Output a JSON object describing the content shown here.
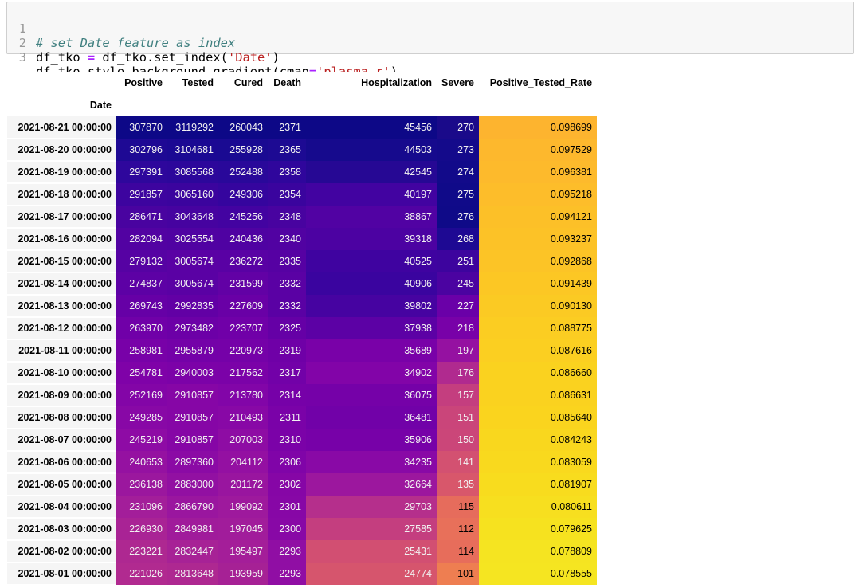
{
  "code_cell": {
    "line_numbers": [
      "1",
      "2",
      "3"
    ],
    "line1": {
      "comment": "# set Date feature as index"
    },
    "line2": {
      "lhs": "df_tko ",
      "op": "=",
      "call": " df_tko.set_index(",
      "arg": "'Date'",
      "close": ")"
    },
    "line3": {
      "call": "df_tko.style.background_gradient(cmap",
      "op": "=",
      "arg": "'plasma_r'",
      "close": ")"
    }
  },
  "table": {
    "index_name": "Date",
    "columns": [
      "Positive",
      "Tested",
      "Cured",
      "Death",
      "Hospitalization",
      "Severe",
      "Positive_Tested_Rate"
    ],
    "rows": [
      {
        "date": "2021-08-21 00:00:00",
        "cells": [
          "307870",
          "3119292",
          "260043",
          "2371",
          "45456",
          "270",
          "0.098699"
        ],
        "bg": [
          "#0d0887",
          "#0d0887",
          "#0d0887",
          "#0d0887",
          "#0d0887",
          "#1a0a8a",
          "#fdb42f"
        ]
      },
      {
        "date": "2021-08-20 00:00:00",
        "cells": [
          "302796",
          "3104681",
          "255928",
          "2365",
          "44503",
          "273",
          "0.097529"
        ],
        "bg": [
          "#1e0994",
          "#1b0993",
          "#1a0a92",
          "#1d0a93",
          "#160a8d",
          "#140a8b",
          "#fdb82d"
        ]
      },
      {
        "date": "2021-08-19 00:00:00",
        "cells": [
          "297391",
          "3085568",
          "252488",
          "2358",
          "42545",
          "274",
          "0.096381"
        ],
        "bg": [
          "#2e079c",
          "#2c079b",
          "#29089a",
          "#2f069c",
          "#260894",
          "#120a8a",
          "#fdba2c"
        ]
      },
      {
        "date": "2021-08-18 00:00:00",
        "cells": [
          "291857",
          "3065160",
          "249306",
          "2354",
          "40197",
          "275",
          "0.095218"
        ],
        "bg": [
          "#3d049f",
          "#3b049e",
          "#35059e",
          "#3a049e",
          "#4203a1",
          "#100a89",
          "#fdbd2a"
        ]
      },
      {
        "date": "2021-08-17 00:00:00",
        "cells": [
          "286471",
          "3043648",
          "245256",
          "2348",
          "38867",
          "276",
          "0.094121"
        ],
        "bg": [
          "#4903a0",
          "#4603a0",
          "#4303a1",
          "#4803a0",
          "#5102a3",
          "#0f0a88",
          "#fcc028"
        ]
      },
      {
        "date": "2021-08-16 00:00:00",
        "cells": [
          "282094",
          "3025554",
          "240436",
          "2340",
          "39318",
          "268",
          "0.093237"
        ],
        "bg": [
          "#5202a2",
          "#5002a2",
          "#4f02a2",
          "#5102a2",
          "#4c02a2",
          "#1e0993",
          "#fcc227"
        ]
      },
      {
        "date": "2021-08-15 00:00:00",
        "cells": [
          "279132",
          "3005674",
          "236272",
          "2335",
          "40525",
          "251",
          "0.092868"
        ],
        "bg": [
          "#5602a3",
          "#5a01a4",
          "#5901a4",
          "#5601a3",
          "#3f03a0",
          "#3d049e",
          "#fcc426"
        ]
      },
      {
        "date": "2021-08-14 00:00:00",
        "cells": [
          "274837",
          "3005674",
          "231599",
          "2332",
          "40906",
          "245",
          "0.091439"
        ],
        "bg": [
          "#5d01a5",
          "#5a01a4",
          "#6201a5",
          "#5a01a4",
          "#3a049f",
          "#4b03a1",
          "#fcc724"
        ]
      },
      {
        "date": "2021-08-13 00:00:00",
        "cells": [
          "269743",
          "2992835",
          "227609",
          "2332",
          "39802",
          "227",
          "0.090130"
        ],
        "bg": [
          "#6600a6",
          "#6200a5",
          "#6900a6",
          "#5a01a4",
          "#4603a1",
          "#6a00a8",
          "#fbca23"
        ]
      },
      {
        "date": "2021-08-12 00:00:00",
        "cells": [
          "263970",
          "2973482",
          "223707",
          "2325",
          "37938",
          "218",
          "0.088775"
        ],
        "bg": [
          "#7000a8",
          "#6c00a7",
          "#7000a8",
          "#6500a6",
          "#5c01a5",
          "#7801a8",
          "#fbcd22"
        ]
      },
      {
        "date": "2021-08-11 00:00:00",
        "cells": [
          "258981",
          "2955879",
          "220973",
          "2319",
          "35689",
          "197",
          "0.087616"
        ],
        "bg": [
          "#7801a8",
          "#7401a8",
          "#7501a8",
          "#6f00a7",
          "#7901a8",
          "#9511a1",
          "#fbcf21"
        ]
      },
      {
        "date": "2021-08-10 00:00:00",
        "cells": [
          "254781",
          "2940003",
          "217562",
          "2317",
          "34902",
          "176",
          "0.086660"
        ],
        "bg": [
          "#7f02a8",
          "#7c02a8",
          "#7b02a8",
          "#7201a8",
          "#8204a8",
          "#b02a8f",
          "#fad21f"
        ]
      },
      {
        "date": "2021-08-09 00:00:00",
        "cells": [
          "252169",
          "2910857",
          "213780",
          "2314",
          "36075",
          "157",
          "0.086631"
        ],
        "bg": [
          "#8305a7",
          "#8606a6",
          "#8205a8",
          "#7601a8",
          "#7501a8",
          "#c43e7f",
          "#fad21f"
        ]
      },
      {
        "date": "2021-08-08 00:00:00",
        "cells": [
          "249285",
          "2910857",
          "210493",
          "2311",
          "36481",
          "151",
          "0.085640"
        ],
        "bg": [
          "#8808a6",
          "#8606a6",
          "#8808a6",
          "#7a02a8",
          "#7101a8",
          "#ca457a",
          "#fad41e"
        ]
      },
      {
        "date": "2021-08-07 00:00:00",
        "cells": [
          "245219",
          "2910857",
          "207003",
          "2310",
          "35906",
          "150",
          "0.084243"
        ],
        "bg": [
          "#8e0ba5",
          "#8606a6",
          "#8e0ca4",
          "#7b02a8",
          "#7701a8",
          "#cb4679",
          "#f9d71e"
        ]
      },
      {
        "date": "2021-08-06 00:00:00",
        "cells": [
          "240653",
          "2897360",
          "204112",
          "2306",
          "34235",
          "141",
          "0.083059"
        ],
        "bg": [
          "#9511a1",
          "#8b0aa5",
          "#9410a2",
          "#8004a8",
          "#8909a6",
          "#d35171",
          "#f9d91e"
        ]
      },
      {
        "date": "2021-08-05 00:00:00",
        "cells": [
          "236138",
          "2883000",
          "201172",
          "2302",
          "32664",
          "135",
          "0.081907"
        ],
        "bg": [
          "#9b179e",
          "#9210a2",
          "#99159f",
          "#8606a6",
          "#9c179e",
          "#d8576b",
          "#f8dc1e"
        ]
      },
      {
        "date": "2021-08-04 00:00:00",
        "cells": [
          "231096",
          "2866790",
          "199092",
          "2301",
          "29703",
          "115",
          "0.080611"
        ],
        "bg": [
          "#a31e9a",
          "#9a169f",
          "#9e199d",
          "#8707a6",
          "#b52f8c",
          "#e66c5c",
          "#f7df1f"
        ]
      },
      {
        "date": "2021-08-03 00:00:00",
        "cells": [
          "226930",
          "2849981",
          "197045",
          "2300",
          "27585",
          "112",
          "0.079625"
        ],
        "bg": [
          "#a92395",
          "#a01b9b",
          "#a11c9b",
          "#8808a6",
          "#c43e7f",
          "#e8705a",
          "#f6e21f"
        ]
      },
      {
        "date": "2021-08-02 00:00:00",
        "cells": [
          "223221",
          "2832447",
          "195497",
          "2293",
          "25431",
          "114",
          "0.078809"
        ],
        "bg": [
          "#ae2891",
          "#a72296",
          "#a41e99",
          "#900ea4",
          "#d24f72",
          "#e76d5b",
          "#f5e421"
        ]
      },
      {
        "date": "2021-08-01 00:00:00",
        "cells": [
          "221026",
          "2813648",
          "193959",
          "2293",
          "24774",
          "101",
          "0.078555"
        ],
        "bg": [
          "#b12a90",
          "#ae2891",
          "#a62195",
          "#900ea4",
          "#d6556d",
          "#ee7e51",
          "#f5e521"
        ]
      }
    ]
  }
}
